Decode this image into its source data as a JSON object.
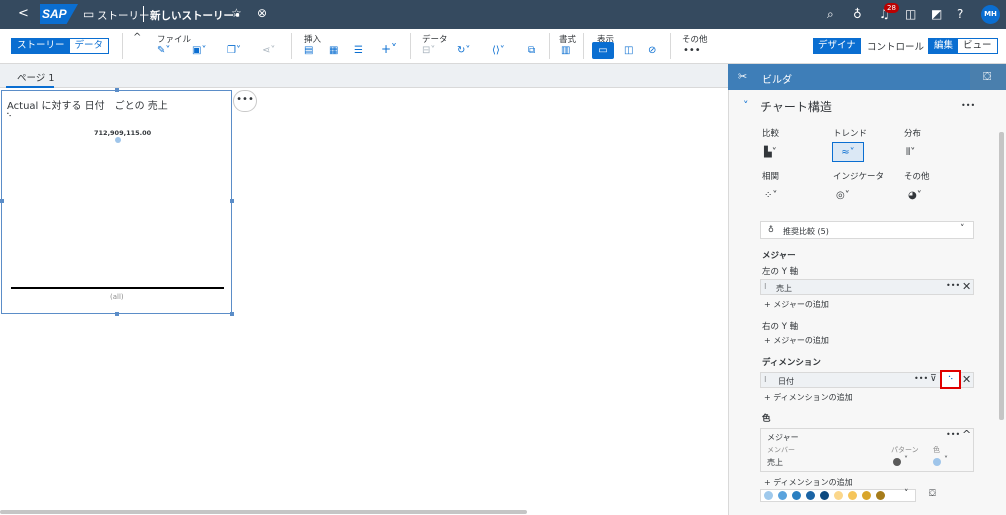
{
  "shell": {
    "back": "<",
    "logo": "SAP",
    "story_label": "ストーリー",
    "story_title": "新しいストーリー",
    "star": "☆",
    "close": "⊗",
    "notif_count": "28",
    "avatar": "MH"
  },
  "toolbar": {
    "view_tabs": [
      "ストーリー",
      "データ"
    ],
    "groups": {
      "file": "ファイル",
      "insert": "挿入",
      "data": "データ",
      "format": "書式",
      "display": "表示",
      "other": "その他"
    },
    "mode": [
      "デザイナ",
      "コントロール"
    ],
    "edit_view": [
      "編集",
      "ビュー"
    ]
  },
  "page_tab": "ページ 1",
  "widget": {
    "title": "Actual に対する 日付　ごとの 売上",
    "value_label": "712,909,115.00",
    "axis_label": "(all)",
    "more": "•••"
  },
  "panel": {
    "header": "ビルダ",
    "chart_structure": "チャート構造",
    "types": [
      "比較",
      "トレンド",
      "分布",
      "相関",
      "インジケータ",
      "その他"
    ],
    "suggest": "推奨比較 (5)",
    "measures_title": "メジャー",
    "left_y": "左の Y 軸",
    "measure_item": "売上",
    "add_measure": "+ メジャーの追加",
    "right_y": "右の Y 軸",
    "add_measure2": "+ メジャーの追加",
    "dimensions_title": "ディメンション",
    "dimension_item": "日付",
    "add_dimension": "+ ディメンションの追加",
    "color_title": "色",
    "color_box_title": "メジャー",
    "color_cols": [
      "メンバー",
      "パターン",
      "色"
    ],
    "color_row": "売上",
    "add_dimension2": "+ ディメンションの追加"
  },
  "palette_colors": [
    "#9fc9ec",
    "#5aa3dd",
    "#2a7fc1",
    "#1b64a5",
    "#0d4a80",
    "#fbd78b",
    "#f5c55b",
    "#d9a52a",
    "#a67c1a"
  ]
}
